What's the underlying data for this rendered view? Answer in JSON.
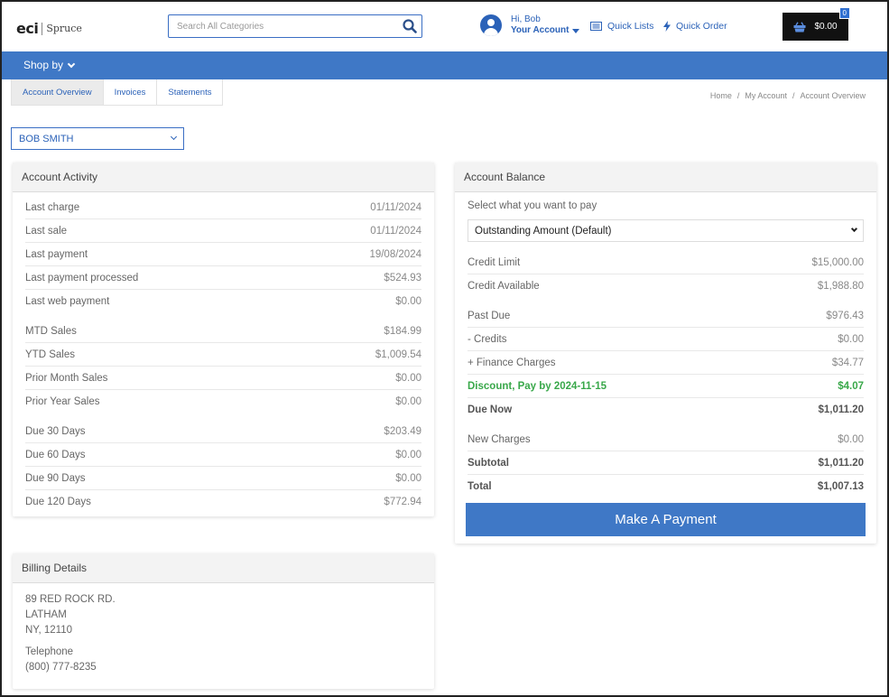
{
  "header": {
    "logo_eci": "eci",
    "logo_spruce": "Spruce",
    "search_placeholder": "Search All Categories",
    "greeting": "Hi, Bob",
    "account_label": "Your Account",
    "quick_lists": "Quick Lists",
    "quick_order": "Quick Order",
    "cart_total": "$0.00",
    "cart_count": "0"
  },
  "nav": {
    "shop_by": "Shop by"
  },
  "tabs": [
    {
      "label": "Account Overview",
      "active": true
    },
    {
      "label": "Invoices",
      "active": false
    },
    {
      "label": "Statements",
      "active": false
    }
  ],
  "breadcrumb": [
    "Home",
    "My Account",
    "Account Overview"
  ],
  "customer_select": "BOB SMITH",
  "activity": {
    "title": "Account Activity",
    "rows": [
      {
        "label": "Last charge",
        "value": "01/11/2024"
      },
      {
        "label": "Last sale",
        "value": "01/11/2024"
      },
      {
        "label": "Last payment",
        "value": "19/08/2024"
      },
      {
        "label": "Last payment processed",
        "value": "$524.93"
      },
      {
        "label": "Last web payment",
        "value": "$0.00"
      },
      {
        "label": "MTD Sales",
        "value": "$184.99"
      },
      {
        "label": "YTD Sales",
        "value": "$1,009.54"
      },
      {
        "label": "Prior Month Sales",
        "value": "$0.00"
      },
      {
        "label": "Prior Year Sales",
        "value": "$0.00"
      },
      {
        "label": "Due 30 Days",
        "value": "$203.49"
      },
      {
        "label": "Due 60 Days",
        "value": "$0.00"
      },
      {
        "label": "Due 90 Days",
        "value": "$0.00"
      },
      {
        "label": "Due 120 Days",
        "value": "$772.94"
      }
    ]
  },
  "balance": {
    "title": "Account Balance",
    "select_label": "Select what you want to pay",
    "select_value": "Outstanding Amount (Default)",
    "rows": [
      {
        "label": "Credit Limit",
        "value": "$15,000.00"
      },
      {
        "label": "Credit Available",
        "value": "$1,988.80"
      },
      {
        "label": "Past Due",
        "value": "$976.43"
      },
      {
        "label": "- Credits",
        "value": "$0.00"
      },
      {
        "label": "+ Finance Charges",
        "value": "$34.77"
      },
      {
        "label": "Discount, Pay by 2024-11-15",
        "value": "$4.07"
      },
      {
        "label": "Due Now",
        "value": "$1,011.20"
      },
      {
        "label": "New Charges",
        "value": "$0.00"
      },
      {
        "label": "Subtotal",
        "value": "$1,011.20"
      },
      {
        "label": "Total",
        "value": "$1,007.13"
      }
    ],
    "pay_button": "Make A Payment"
  },
  "billing": {
    "title": "Billing Details",
    "line1": "89 RED ROCK RD.",
    "line2": "LATHAM",
    "line3": "NY, 12110",
    "phone_label": "Telephone",
    "phone": "(800) 777-8235"
  },
  "colors": {
    "accent": "#3f78c6",
    "link": "#2b62b8",
    "discount": "#39a84a"
  }
}
